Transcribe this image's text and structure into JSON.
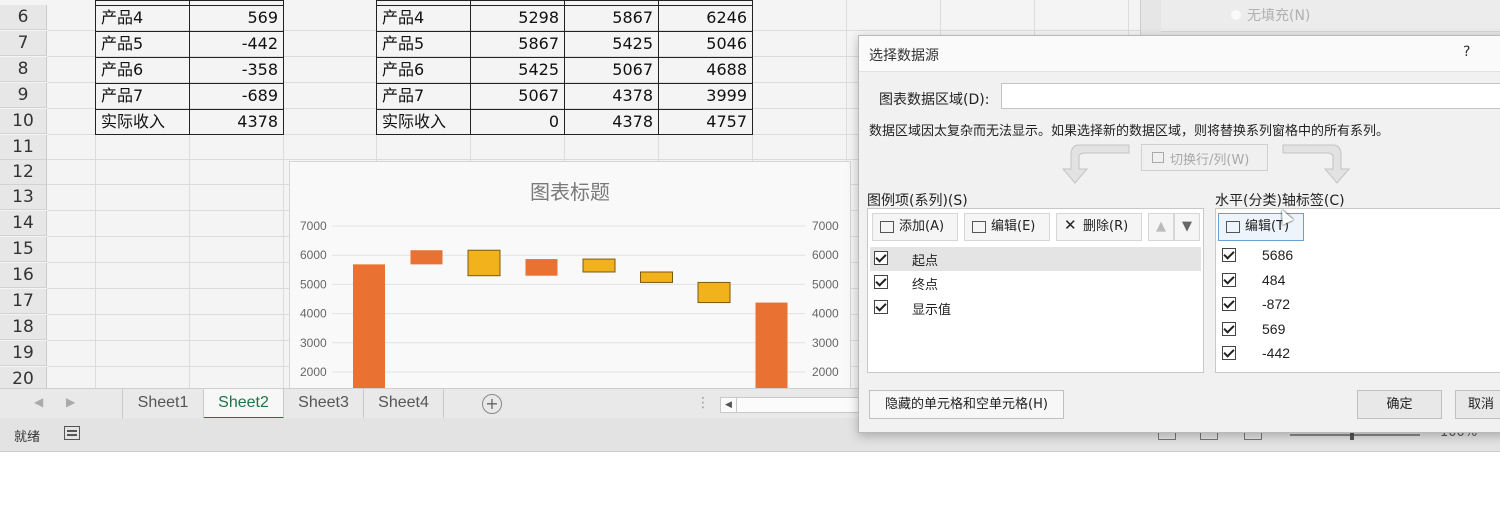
{
  "row_numbers": [
    "6",
    "7",
    "8",
    "9",
    "10",
    "11",
    "12",
    "13",
    "14",
    "15",
    "16",
    "17",
    "18",
    "19",
    "20"
  ],
  "table_left": {
    "rows": [
      {
        "name": "产品4",
        "value": "569"
      },
      {
        "name": "产品5",
        "value": "-442"
      },
      {
        "name": "产品6",
        "value": "-358"
      },
      {
        "name": "产品7",
        "value": "-689"
      },
      {
        "name": "实际收入",
        "value": "4378"
      }
    ]
  },
  "table_right": {
    "rows": [
      {
        "name": "产品4",
        "v1": "5298",
        "v2": "5867",
        "v3": "6246"
      },
      {
        "name": "产品5",
        "v1": "5867",
        "v2": "5425",
        "v3": "5046"
      },
      {
        "name": "产品6",
        "v1": "5425",
        "v2": "5067",
        "v3": "4688"
      },
      {
        "name": "产品7",
        "v1": "5067",
        "v2": "4378",
        "v3": "3999"
      },
      {
        "name": "实际收入",
        "v1": "0",
        "v2": "4378",
        "v3": "4757"
      }
    ]
  },
  "chart_data": {
    "type": "bar",
    "title": "图表标题",
    "y_ticks": [
      "7000",
      "6000",
      "5000",
      "4000",
      "3000",
      "2000"
    ],
    "ylim": [
      1500,
      7500
    ],
    "colors": {
      "base": "#E97132",
      "float": "#F2B21C",
      "float_border": "#7a5a10"
    },
    "bars": [
      {
        "kind": "base",
        "low": 0,
        "high": 5686
      },
      {
        "kind": "base",
        "low": 5686,
        "high": 6170
      },
      {
        "kind": "float",
        "low": 5298,
        "high": 6170
      },
      {
        "kind": "base",
        "low": 5298,
        "high": 5867
      },
      {
        "kind": "float",
        "low": 5425,
        "high": 5867
      },
      {
        "kind": "float",
        "low": 5067,
        "high": 5425
      },
      {
        "kind": "float",
        "low": 4378,
        "high": 5067
      },
      {
        "kind": "base",
        "low": 0,
        "high": 4378
      }
    ]
  },
  "sheets": {
    "tabs": [
      "Sheet1",
      "Sheet2",
      "Sheet3",
      "Sheet4"
    ],
    "active": "Sheet2"
  },
  "status": {
    "text": "就绪",
    "zoom": "100%"
  },
  "format_pane": {
    "option": "无填充(N)"
  },
  "dialog": {
    "title": "选择数据源",
    "help": "?",
    "range_label": "图表数据区域(D):",
    "range_value": "",
    "notice": "数据区域因太复杂而无法显示。如果选择新的数据区域，则将替换系列窗格中的所有系列。",
    "switch_label": "切换行/列(W)",
    "legend_label": "图例项(系列)(S)",
    "axis_label": "水平(分类)轴标签(C)",
    "add_label": "添加(A)",
    "edit_label": "编辑(E)",
    "delete_label": "删除(R)",
    "axis_edit_label": "编辑(T)",
    "series": [
      "起点",
      "终点",
      "显示值"
    ],
    "axis_values": [
      "5686",
      "484",
      "-872",
      "569",
      "-442"
    ],
    "hidden_cells_label": "隐藏的单元格和空单元格(H)",
    "ok_label": "确定",
    "cancel_label": "取消"
  }
}
